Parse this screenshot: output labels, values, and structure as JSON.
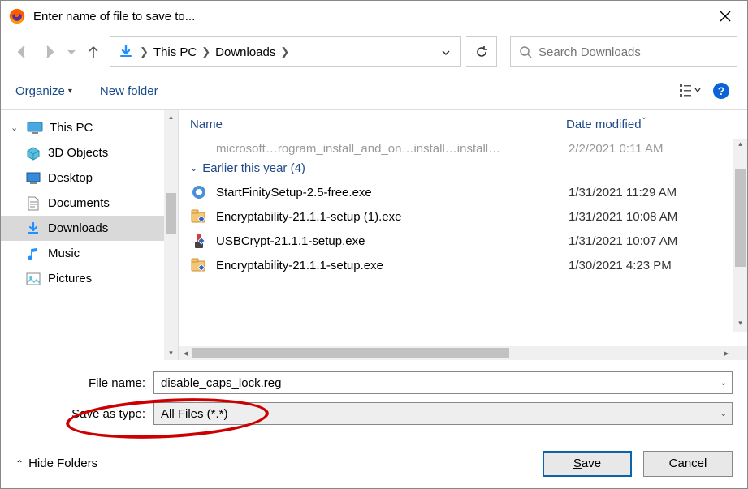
{
  "title": "Enter name of file to save to...",
  "breadcrumb": {
    "seg1": "This PC",
    "seg2": "Downloads"
  },
  "search": {
    "placeholder": "Search Downloads"
  },
  "toolbar": {
    "organize": "Organize",
    "new_folder": "New folder"
  },
  "sidebar": {
    "root": "This PC",
    "items": [
      "3D Objects",
      "Desktop",
      "Documents",
      "Downloads",
      "Music",
      "Pictures"
    ]
  },
  "columns": {
    "name": "Name",
    "date": "Date modified"
  },
  "truncated_row": {
    "name": "microsoft…rogram_install_and_on…install…install…",
    "date": "2/2/2021  0:11 AM"
  },
  "group": "Earlier this year (4)",
  "files": [
    {
      "name": "StartFinitySetup-2.5-free.exe",
      "date": "1/31/2021 11:29 AM"
    },
    {
      "name": "Encryptability-21.1.1-setup (1).exe",
      "date": "1/31/2021 10:08 AM"
    },
    {
      "name": "USBCrypt-21.1.1-setup.exe",
      "date": "1/31/2021 10:07 AM"
    },
    {
      "name": "Encryptability-21.1.1-setup.exe",
      "date": "1/30/2021 4:23 PM"
    }
  ],
  "inputs": {
    "filename_label": "File name:",
    "filename_value": "disable_caps_lock.reg",
    "type_label": "Save as type:",
    "type_value": "All Files (*.*)"
  },
  "footer": {
    "hide_folders": "Hide Folders",
    "save_rest": "ave",
    "cancel": "Cancel"
  }
}
